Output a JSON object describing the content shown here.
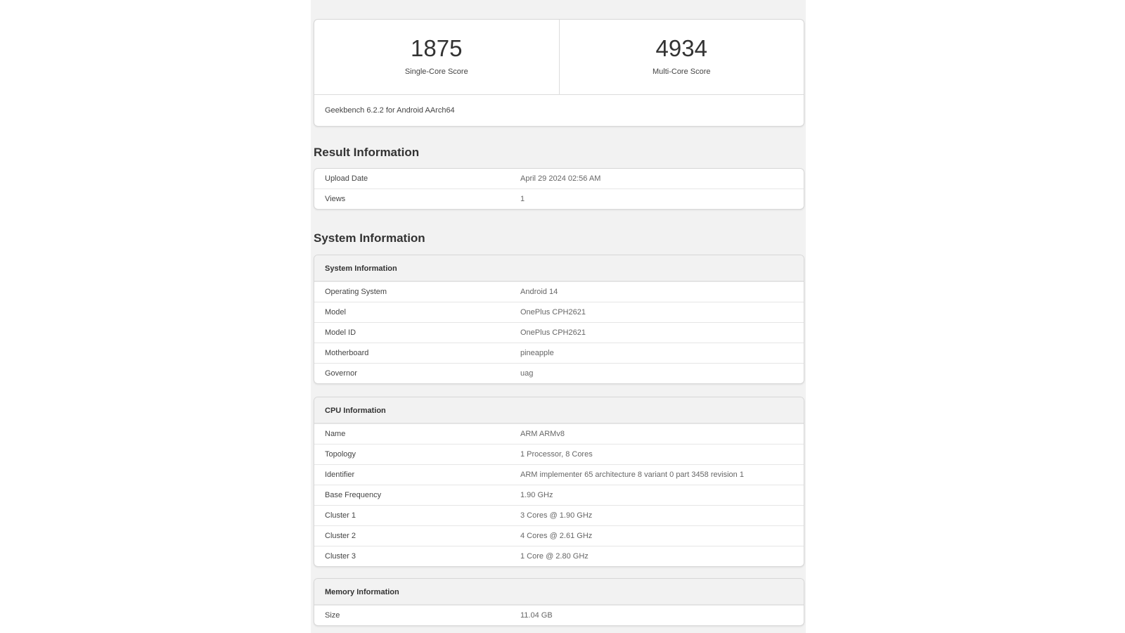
{
  "scores": {
    "single": {
      "value": "1875",
      "label": "Single-Core Score"
    },
    "multi": {
      "value": "4934",
      "label": "Multi-Core Score"
    },
    "version": "Geekbench 6.2.2 for Android AArch64"
  },
  "result_section": {
    "title": "Result Information",
    "rows": [
      {
        "key": "Upload Date",
        "value": "April 29 2024 02:56 AM"
      },
      {
        "key": "Views",
        "value": "1"
      }
    ]
  },
  "system_section": {
    "title": "System Information"
  },
  "system_info": {
    "header": "System Information",
    "rows": [
      {
        "key": "Operating System",
        "value": "Android 14"
      },
      {
        "key": "Model",
        "value": "OnePlus CPH2621"
      },
      {
        "key": "Model ID",
        "value": "OnePlus CPH2621"
      },
      {
        "key": "Motherboard",
        "value": "pineapple"
      },
      {
        "key": "Governor",
        "value": "uag"
      }
    ]
  },
  "cpu_info": {
    "header": "CPU Information",
    "rows": [
      {
        "key": "Name",
        "value": "ARM ARMv8"
      },
      {
        "key": "Topology",
        "value": "1 Processor, 8 Cores"
      },
      {
        "key": "Identifier",
        "value": "ARM implementer 65 architecture 8 variant 0 part 3458 revision 1"
      },
      {
        "key": "Base Frequency",
        "value": "1.90 GHz"
      },
      {
        "key": "Cluster 1",
        "value": "3 Cores @ 1.90 GHz"
      },
      {
        "key": "Cluster 2",
        "value": "4 Cores @ 2.61 GHz"
      },
      {
        "key": "Cluster 3",
        "value": "1 Core @ 2.80 GHz"
      }
    ]
  },
  "memory_info": {
    "header": "Memory Information",
    "rows": [
      {
        "key": "Size",
        "value": "11.04 GB"
      }
    ]
  }
}
